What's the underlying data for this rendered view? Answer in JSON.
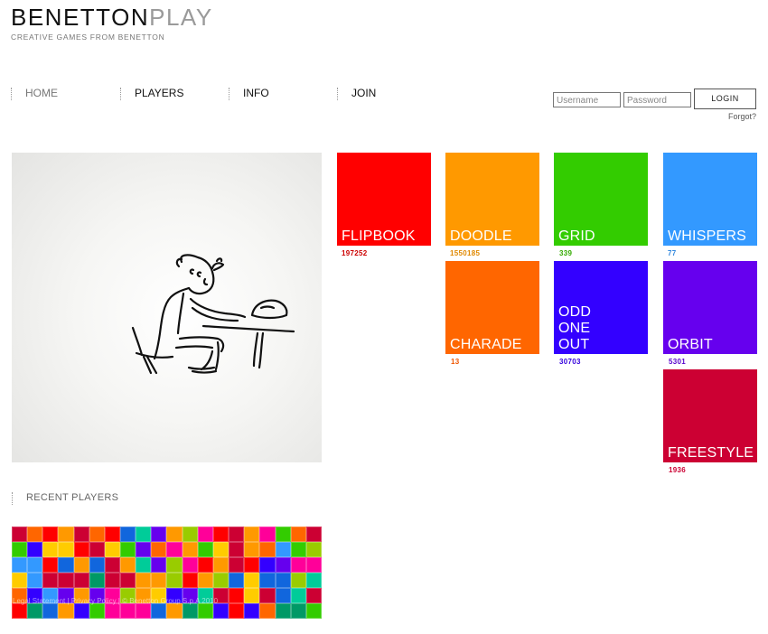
{
  "brand": {
    "part1": "BENETTON",
    "part2": "PLAY",
    "tagline": "CREATIVE GAMES FROM BENETTON"
  },
  "nav": [
    {
      "label": "HOME",
      "active": true
    },
    {
      "label": "PLAYERS",
      "active": false
    },
    {
      "label": "INFO",
      "active": false
    },
    {
      "label": "JOIN",
      "active": false
    }
  ],
  "login": {
    "username_placeholder": "Username",
    "password_placeholder": "Password",
    "button_label": "LOGIN",
    "forgot_label": "Forgot?"
  },
  "games": [
    {
      "label": "FLIPBOOK",
      "count": "197252",
      "color": "#ff0000"
    },
    {
      "label": "DOODLE",
      "count": "1550185",
      "color": "#ff9900"
    },
    {
      "label": "GRID",
      "count": "339",
      "color": "#33cc00"
    },
    {
      "label": "WHISPERS",
      "count": "77",
      "color": "#3399ff"
    },
    {
      "label": "CHARADE",
      "count": "13",
      "color": "#ff6600"
    },
    {
      "label": "ODD\nONE\nOUT",
      "count": "30703",
      "color": "#3300ff"
    },
    {
      "label": "ORBIT",
      "count": "5301",
      "color": "#6600ee"
    },
    {
      "label": "FREESTYLE",
      "count": "1936",
      "color": "#cc0033"
    }
  ],
  "recent": {
    "title": "RECENT PLAYERS"
  },
  "footer": {
    "text": "Legal Statement | Privacy Policy | © Benetton Group S.p.A 2010"
  },
  "mosaic_palette": [
    "#3300ff",
    "#ff0000",
    "#33cc00",
    "#ff9900",
    "#3399ff",
    "#6600ee",
    "#cc0033",
    "#ff6600",
    "#00cc99",
    "#ff0099",
    "#99cc00",
    "#009966",
    "#1166dd",
    "#ffcc00"
  ]
}
